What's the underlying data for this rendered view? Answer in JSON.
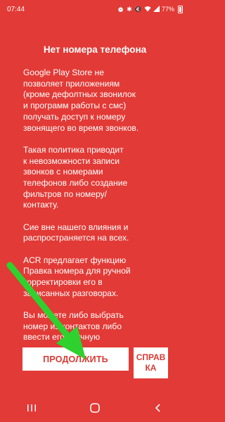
{
  "status_bar": {
    "time": "07:44",
    "battery_text": "77%",
    "icons": [
      "alarm-icon",
      "bluetooth-icon",
      "mute-icon",
      "wifi-icon",
      "signal-icon",
      "battery-icon"
    ]
  },
  "dialog": {
    "title": "Нет номера телефона",
    "paragraphs": [
      "Google Play Store не\nпозволяет приложениям\n(кроме дефолтных звонилок\nи программ работы с смс)\nполучать доступ к номеру\nзвонящего во время звонков.",
      "Такая политика приводит\nк невозможности записи\nзвонков с номерами\nтелефонов либо создание\nфильтров по номеру/\nконтакту.",
      "Сие вне нашего влияния и\nраспространяется на всех.",
      "ACR предлагает функцию\nПравка номера для ручной\nкорректировки его в\nзаписанных разговорах.",
      "Вы можете либо выбрать\nномер из контактов либо\nввести его вручную"
    ],
    "continue_label": "ПРОДОЛЖИТЬ",
    "help_label": "СПРАВ\nКА"
  },
  "colors": {
    "background": "#e23a36",
    "button_text": "#d93a34",
    "arrow": "#2ed12e"
  },
  "nav_bar": {
    "icons": [
      "recents-icon",
      "home-icon",
      "back-icon"
    ]
  }
}
